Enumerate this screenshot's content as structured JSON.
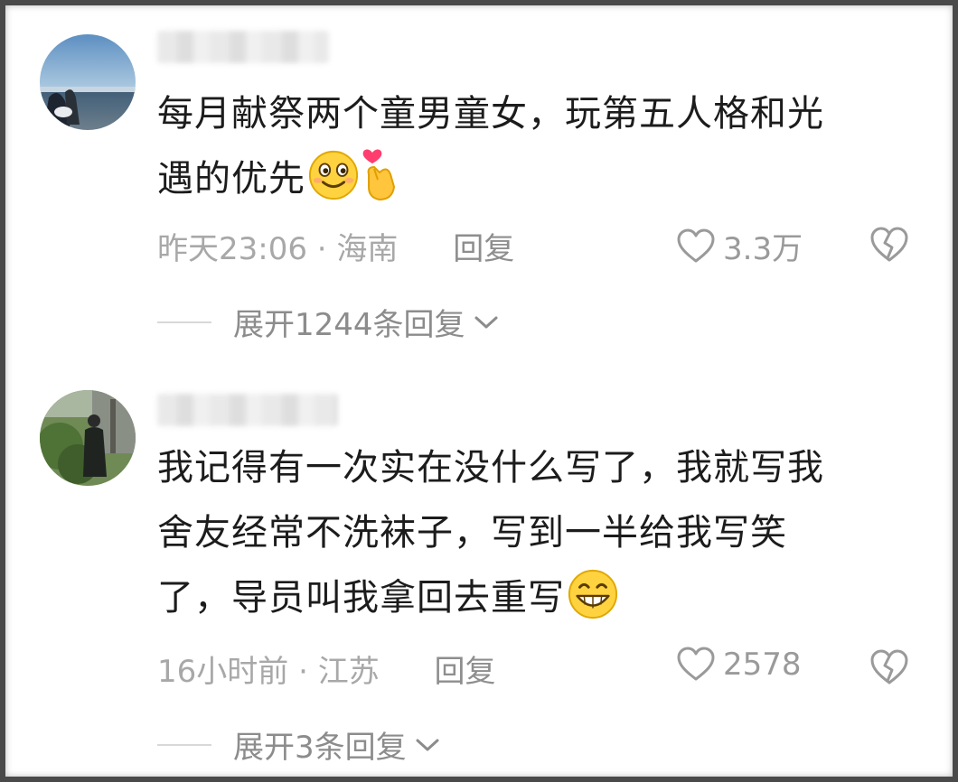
{
  "comments": [
    {
      "avatar": "ocean-landscape-avatar",
      "lines": [
        "每月献祭两个童男童女，玩第五人格和光",
        "遇的优先"
      ],
      "trailing_emojis": [
        "smiling-face-emoji",
        "heart-finger-emoji"
      ],
      "time": "昨天23:06",
      "separator": "·",
      "location": "海南",
      "reply_label": "回复",
      "likes": "3.3万",
      "expand_label": "展开1244条回复"
    },
    {
      "avatar": "person-outdoor-avatar",
      "lines": [
        "我记得有一次实在没什么写了，我就写我",
        "舍友经常不洗袜子，写到一半给我写笑",
        "了，导员叫我拿回去重写"
      ],
      "trailing_emojis": [
        "grinning-face-emoji"
      ],
      "time": "16小时前",
      "separator": "·",
      "location": "江苏",
      "reply_label": "回复",
      "likes": "2578",
      "expand_label": "展开3条回复"
    }
  ],
  "colors": {
    "text": "#1c1c1c",
    "meta": "#a8a8a8",
    "icon": "#9a9a9a",
    "border": "#4a4a4a"
  }
}
